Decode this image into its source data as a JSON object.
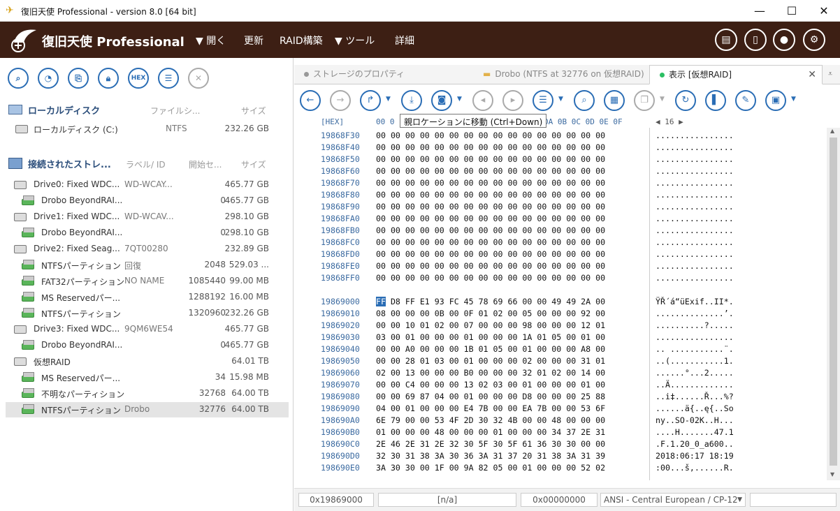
{
  "window": {
    "title": "復旧天使 Professional - version 8.0 [64 bit]",
    "minimize": "—",
    "maximize": "☐",
    "close": "✕"
  },
  "header": {
    "brand": "復旧天使 Professional",
    "menu": [
      {
        "label": "▼ 開く"
      },
      {
        "label": "更新"
      },
      {
        "label": "RAID構築"
      },
      {
        "label": "▼ ツール"
      },
      {
        "label": "詳細"
      }
    ],
    "icons": [
      "list-view-icon",
      "panel-icon",
      "user-icon",
      "settings-icon"
    ]
  },
  "left": {
    "toolbar_icons": [
      "search-icon",
      "disk-chart-icon",
      "image-icon",
      "lock-icon",
      "hex-icon",
      "list-icon",
      "close-icon"
    ],
    "hex_label": "HEX",
    "local_section": {
      "title": "ローカルディスク",
      "col_fs": "ファイルシ...",
      "col_size": "サイズ"
    },
    "local_rows": [
      {
        "name": "ローカルディスク (C:)",
        "fs": "NTFS",
        "size": "232.26 GB"
      }
    ],
    "connected_section": {
      "title": "接続されたストレ...",
      "col_label": "ラベル/ ID",
      "col_start": "開始セ...",
      "col_size": "サイズ"
    },
    "rows": [
      {
        "type": "disk",
        "name": "Drive0: Fixed WDC...",
        "label": "WD-WCAY...",
        "start": "",
        "size": "465.77 GB"
      },
      {
        "type": "part",
        "name": "Drobo BeyondRAI...",
        "label": "",
        "start": "0",
        "size": "465.77 GB"
      },
      {
        "type": "disk",
        "name": "Drive1: Fixed WDC...",
        "label": "WD-WCAV...",
        "start": "",
        "size": "298.10 GB"
      },
      {
        "type": "part",
        "name": "Drobo BeyondRAI...",
        "label": "",
        "start": "0",
        "size": "298.10 GB"
      },
      {
        "type": "disk",
        "name": "Drive2: Fixed Seag...",
        "label": "7QT00280",
        "start": "",
        "size": "232.89 GB"
      },
      {
        "type": "part",
        "name": "NTFSパーティション",
        "label": "回復",
        "start": "2048",
        "size": "529.03 ..."
      },
      {
        "type": "part",
        "name": "FAT32パーティション",
        "label": "NO NAME",
        "start": "1085440",
        "size": "99.00 MB"
      },
      {
        "type": "part",
        "name": "MS Reservedパー...",
        "label": "",
        "start": "1288192",
        "size": "16.00 MB"
      },
      {
        "type": "part",
        "name": "NTFSパーティション",
        "label": "",
        "start": "1320960",
        "size": "232.26 GB"
      },
      {
        "type": "disk",
        "name": "Drive3: Fixed WDC...",
        "label": "9QM6WE54",
        "start": "",
        "size": "465.77 GB"
      },
      {
        "type": "part",
        "name": "Drobo BeyondRAI...",
        "label": "",
        "start": "0",
        "size": "465.77 GB"
      },
      {
        "type": "raid",
        "name": "仮想RAID",
        "label": "",
        "start": "",
        "size": "64.01 TB"
      },
      {
        "type": "part",
        "name": "MS Reservedパー...",
        "label": "",
        "start": "34",
        "size": "15.98 MB"
      },
      {
        "type": "part",
        "name": "不明なパーティション",
        "label": "",
        "start": "32768",
        "size": "64.00 TB"
      },
      {
        "type": "part",
        "name": "NTFSパーティション",
        "label": "Drobo",
        "start": "32776",
        "size": "64.00 TB",
        "selected": true
      }
    ]
  },
  "tabs": [
    {
      "label": "ストレージのプロパティ"
    },
    {
      "label": "Drobo (NTFS at 32776 on 仮想RAID)"
    },
    {
      "label": "表示 [仮想RAID]"
    }
  ],
  "tab_close": "✕",
  "toolbar": {
    "icons": [
      "back-icon",
      "forward-icon",
      "redo-icon",
      "download-icon",
      "bookmark-icon",
      "prev-bookmark-icon",
      "next-bookmark-icon",
      "list-icon",
      "search-icon",
      "grid-icon",
      "copy-icon",
      "refresh-icon",
      "panel-icon",
      "edit-icon",
      "save-icon"
    ],
    "tooltip": "親ロケーションに移動 (Ctrl+Down)"
  },
  "columns": {
    "label": "[HEX]",
    "first": "00 0",
    "rest": "0A 0B 0C 0D 0E 0F",
    "width_ctrl": "◀  16  ▶"
  },
  "hex_rows": [
    {
      "addr": "19868F30",
      "bytes": "00 00 00 00 00 00 00 00 00 00 00 00 00 00 00 00",
      "ascii": "................"
    },
    {
      "addr": "19868F40",
      "bytes": "00 00 00 00 00 00 00 00 00 00 00 00 00 00 00 00",
      "ascii": "................"
    },
    {
      "addr": "19868F50",
      "bytes": "00 00 00 00 00 00 00 00 00 00 00 00 00 00 00 00",
      "ascii": "................"
    },
    {
      "addr": "19868F60",
      "bytes": "00 00 00 00 00 00 00 00 00 00 00 00 00 00 00 00",
      "ascii": "................"
    },
    {
      "addr": "19868F70",
      "bytes": "00 00 00 00 00 00 00 00 00 00 00 00 00 00 00 00",
      "ascii": "................"
    },
    {
      "addr": "19868F80",
      "bytes": "00 00 00 00 00 00 00 00 00 00 00 00 00 00 00 00",
      "ascii": "................"
    },
    {
      "addr": "19868F90",
      "bytes": "00 00 00 00 00 00 00 00 00 00 00 00 00 00 00 00",
      "ascii": "................"
    },
    {
      "addr": "19868FA0",
      "bytes": "00 00 00 00 00 00 00 00 00 00 00 00 00 00 00 00",
      "ascii": "................"
    },
    {
      "addr": "19868FB0",
      "bytes": "00 00 00 00 00 00 00 00 00 00 00 00 00 00 00 00",
      "ascii": "................"
    },
    {
      "addr": "19868FC0",
      "bytes": "00 00 00 00 00 00 00 00 00 00 00 00 00 00 00 00",
      "ascii": "................"
    },
    {
      "addr": "19868FD0",
      "bytes": "00 00 00 00 00 00 00 00 00 00 00 00 00 00 00 00",
      "ascii": "................"
    },
    {
      "addr": "19868FE0",
      "bytes": "00 00 00 00 00 00 00 00 00 00 00 00 00 00 00 00",
      "ascii": "................"
    },
    {
      "addr": "19868FF0",
      "bytes": "00 00 00 00 00 00 00 00 00 00 00 00 00 00 00 00",
      "ascii": "................"
    },
    {
      "addr": "",
      "bytes": "",
      "ascii": ""
    },
    {
      "addr": "19869000",
      "first": "FF",
      "bytes": " D8 FF E1 93 FC 45 78 69 66 00 00 49 49 2A 00",
      "ascii": "ŸŘ´á“üExif..II*."
    },
    {
      "addr": "19869010",
      "bytes": "08 00 00 00 0B 00 0F 01 02 00 05 00 00 00 92 00",
      "ascii": "..............’."
    },
    {
      "addr": "19869020",
      "bytes": "00 00 10 01 02 00 07 00 00 00 98 00 00 00 12 01",
      "ascii": "..........?....."
    },
    {
      "addr": "19869030",
      "bytes": "03 00 01 00 00 00 01 00 00 00 1A 01 05 00 01 00",
      "ascii": "................"
    },
    {
      "addr": "19869040",
      "bytes": "00 00 A0 00 00 00 1B 01 05 00 01 00 00 00 A8 00",
      "ascii": ".. ...........¨."
    },
    {
      "addr": "19869050",
      "bytes": "00 00 28 01 03 00 01 00 00 00 02 00 00 00 31 01",
      "ascii": "..(...........1."
    },
    {
      "addr": "19869060",
      "bytes": "02 00 13 00 00 00 B0 00 00 00 32 01 02 00 14 00",
      "ascii": "......°...2....."
    },
    {
      "addr": "19869070",
      "bytes": "00 00 C4 00 00 00 13 02 03 00 01 00 00 00 01 00",
      "ascii": "..Ä............."
    },
    {
      "addr": "19869080",
      "bytes": "00 00 69 87 04 00 01 00 00 00 D8 00 00 00 25 88",
      "ascii": "..i‡......Ř...%?"
    },
    {
      "addr": "19869090",
      "bytes": "04 00 01 00 00 00 E4 7B 00 00 EA 7B 00 00 53 6F",
      "ascii": "......ä{..ę{..So"
    },
    {
      "addr": "198690A0",
      "bytes": "6E 79 00 00 53 4F 2D 30 32 4B 00 00 48 00 00 00",
      "ascii": "ny..SO-02K..H..."
    },
    {
      "addr": "198690B0",
      "bytes": "01 00 00 00 48 00 00 00 01 00 00 00 34 37 2E 31",
      "ascii": "....H.......47.1"
    },
    {
      "addr": "198690C0",
      "bytes": "2E 46 2E 31 2E 32 30 5F 30 5F 61 36 30 30 00 00",
      "ascii": ".F.1.20_0_a600.."
    },
    {
      "addr": "198690D0",
      "bytes": "32 30 31 38 3A 30 36 3A 31 37 20 31 38 3A 31 39",
      "ascii": "2018:06:17 18:19"
    },
    {
      "addr": "198690E0",
      "bytes": "3A 30 30 00 1F 00 9A 82 05 00 01 00 00 00 52 02",
      "ascii": ":00...š,......R."
    }
  ],
  "status": {
    "offset": "0x19869000",
    "na": "[n/a]",
    "value": "0x00000000",
    "encoding": "ANSI - Central European / CP-12",
    "arrow": "▼"
  }
}
